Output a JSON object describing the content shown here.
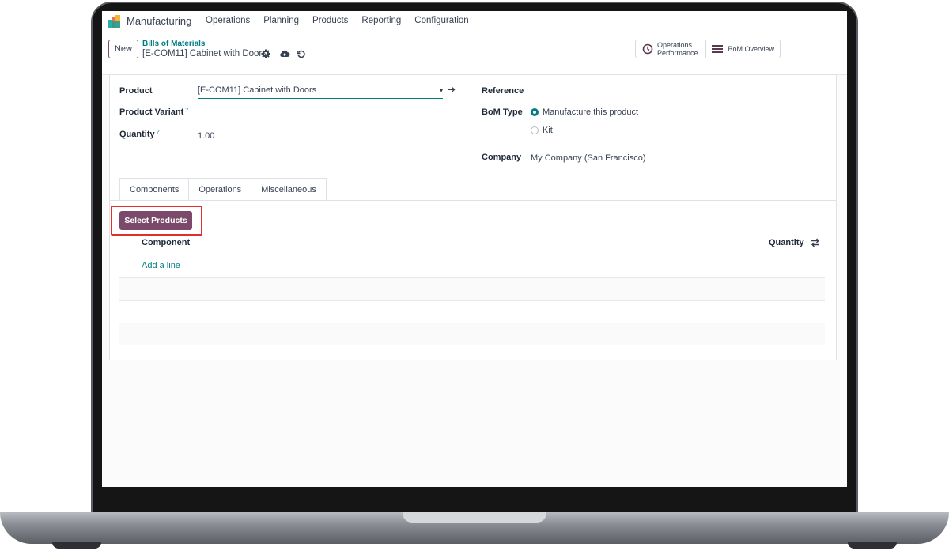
{
  "navbar": {
    "app_title": "Manufacturing",
    "menu": [
      "Operations",
      "Planning",
      "Products",
      "Reporting",
      "Configuration"
    ]
  },
  "control": {
    "new_label": "New",
    "breadcrumb": "Bills of Materials",
    "record_name": "[E-COM11] Cabinet with Doors",
    "stat_ops_line1": "Operations",
    "stat_ops_line2": "Performance",
    "stat_bom": "BoM Overview"
  },
  "form": {
    "product_label": "Product",
    "product_value": "[E-COM11] Cabinet with Doors",
    "variant_label": "Product Variant",
    "quantity_label": "Quantity",
    "quantity_value": "1.00",
    "help_mark": "?",
    "reference_label": "Reference",
    "bom_type_label": "BoM Type",
    "bom_type_options": [
      "Manufacture this product",
      "Kit"
    ],
    "bom_type_selected": "Manufacture this product",
    "company_label": "Company",
    "company_value": "My Company (San Francisco)"
  },
  "tabs": [
    "Components",
    "Operations",
    "Miscellaneous"
  ],
  "components": {
    "select_products_label": "Select Products",
    "column_component": "Component",
    "column_quantity": "Quantity",
    "add_line": "Add a line"
  },
  "colors": {
    "brand": "#7b4a6a",
    "link": "#017e84",
    "highlight": "#e0302a"
  }
}
